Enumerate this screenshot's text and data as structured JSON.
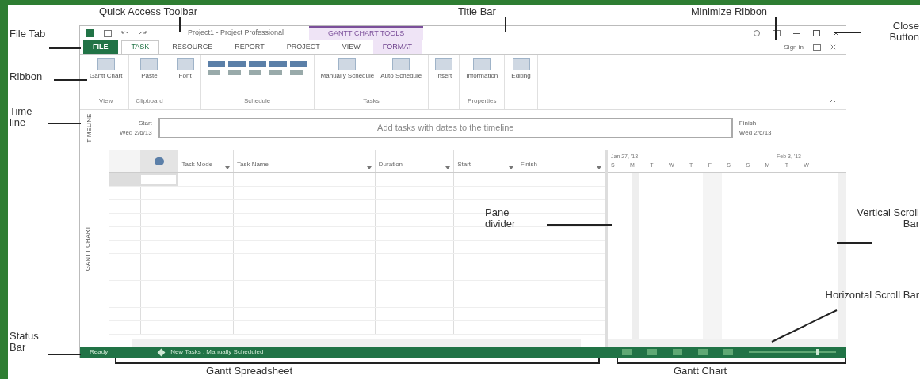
{
  "window": {
    "title": "Project1 - Project Professional",
    "context_tab": "GANTT CHART TOOLS",
    "sign_in": "Sign in"
  },
  "tabs": [
    {
      "label": "FILE",
      "kind": "file",
      "selected": false
    },
    {
      "label": "TASK",
      "kind": "tab",
      "selected": true
    },
    {
      "label": "RESOURCE",
      "kind": "tab",
      "selected": false
    },
    {
      "label": "REPORT",
      "kind": "tab",
      "selected": false
    },
    {
      "label": "PROJECT",
      "kind": "tab",
      "selected": false
    },
    {
      "label": "VIEW",
      "kind": "tab",
      "selected": false
    },
    {
      "label": "FORMAT",
      "kind": "context",
      "selected": false
    }
  ],
  "ribbon": [
    {
      "label": "View",
      "buttons": [
        "Gantt Chart"
      ]
    },
    {
      "label": "Clipboard",
      "buttons": [
        "Paste"
      ]
    },
    {
      "buttons": [
        "Font"
      ]
    },
    {
      "label": "Schedule"
    },
    {
      "label": "Tasks",
      "buttons": [
        "Manually Schedule",
        "Auto Schedule"
      ]
    },
    {
      "buttons": [
        "Insert"
      ]
    },
    {
      "label": "Properties",
      "buttons": [
        "Information"
      ]
    },
    {
      "buttons": [
        "Editing"
      ]
    }
  ],
  "timeline": {
    "side_label": "TIMELINE",
    "start_label": "Start",
    "start_date": "Wed 2/6/13",
    "placeholder": "Add tasks with dates to the timeline",
    "finish_label": "Finish",
    "finish_date": "Wed 2/6/13"
  },
  "table": {
    "side_label": "GANTT CHART",
    "columns": [
      "Task Mode",
      "Task Name",
      "Duration",
      "Start",
      "Finish"
    ]
  },
  "gantt": {
    "weeks": [
      "Jan 27, '13",
      "Feb 3, '13"
    ],
    "days": [
      "S",
      "M",
      "T",
      "W",
      "T",
      "F",
      "S",
      "S",
      "M",
      "T",
      "W"
    ]
  },
  "status_bar": {
    "ready": "Ready",
    "new_tasks": "New Tasks : Manually Scheduled",
    "zoom": {
      "level": 0.8
    }
  },
  "annotations": [
    "Quick Access Toolbar",
    "Title Bar",
    "Minimize Ribbon",
    "Close Button",
    "File Tab",
    "Ribbon",
    "Time line",
    "Pane divider",
    "Vertical Scroll Bar",
    "Horizontal Scroll Bar",
    "Status Bar",
    "Gantt Spreadsheet",
    "Gantt Chart"
  ]
}
